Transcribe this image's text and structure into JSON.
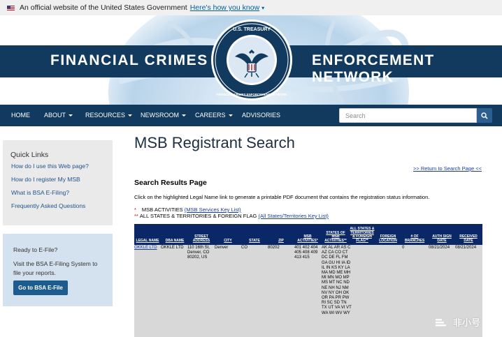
{
  "gov_banner": {
    "text": "An official website of the United States Government",
    "link": "Here's how you know",
    "chevron": "chevron-down-icon"
  },
  "header": {
    "left_title": "FINANCIAL CRIMES",
    "right_title": "ENFORCEMENT NETWORK",
    "seal_top_text": "U.S. TREASURY",
    "seal_ring_text": "FINANCIAL CRIMES ENFORCEMENT NETWORK",
    "brand_color": "#123a5e"
  },
  "nav": {
    "items": [
      {
        "label": "HOME",
        "dropdown": false
      },
      {
        "label": "ABOUT",
        "dropdown": true
      },
      {
        "label": "RESOURCES",
        "dropdown": true
      },
      {
        "label": "NEWSROOM",
        "dropdown": true
      },
      {
        "label": "CAREERS",
        "dropdown": true
      },
      {
        "label": "ADVISORIES",
        "dropdown": false
      }
    ],
    "search_placeholder": "Search",
    "search_icon": "search-icon"
  },
  "sidebar": {
    "quick_links_title": "Quick Links",
    "quick_links": [
      "How do I use this Web page?",
      "How do I register My MSB",
      "What is BSA E-Filing?",
      "Frequently Asked Questions"
    ],
    "efile": {
      "title": "Ready to E-File?",
      "text": "Visit the BSA E-Filing System to file your reports.",
      "button": "Go to BSA E-File"
    }
  },
  "main": {
    "title": "MSB Registrant Search",
    "return_link": ">> Return to Search Page <<",
    "results_heading": "Search Results Page",
    "instructions": "Click on the highlighted Legal Name link to generate a printable PDF document that contains the registration status information.",
    "legend": [
      {
        "marker": "*",
        "text": "MSB ACTIVITIES",
        "link": "(MSB Services Key List)"
      },
      {
        "marker": "**",
        "text": "ALL STATES & TERRITORIES & FOREIGN FLAG",
        "link": "(All States/Territories Key List)"
      }
    ]
  },
  "table": {
    "columns": [
      "LEGAL NAME",
      "DBA NAME",
      "STREET ADDRESS",
      "CITY",
      "STATE",
      "ZIP",
      "MSB ACTIVITIES*",
      "STATES OF MSB ACTIVITIES**",
      "ALL STATES & TERRITORIES & FOREIGN FLAG**",
      "FOREIGN LOCATION",
      "# OF BRANCHES",
      "AUTH SIGN DATE",
      "RECEIVED DATE"
    ],
    "rows": [
      {
        "legal_name": "OKKLE LTD",
        "dba_name": "OKKLE LTD",
        "street": "110 16th St, Denver, CO 80202, US",
        "city": "Denver",
        "state": "CO",
        "zip": "80202",
        "activities": "401 402 404 405 408 409 413 415",
        "states": "AK AL AR AS C AZ CA CO CT DC DE FL FM GA GU HI IA ID IL IN KS KY LA MA MD ME MH MI MN MO MP MS MT NC ND NE NH NJ NM NV NY OH OK OR PA PR PW RI SC SD TN TX UT VA VI VT WA WI WV WY",
        "all_states": "",
        "foreign_location": "",
        "branches": "0",
        "auth_sign_date": "08/21/2024",
        "received_date": "08/21/2024"
      }
    ],
    "header_color": "#0b2866",
    "body_color": "#d8d8d8"
  },
  "watermark": {
    "text": "非小号",
    "icon": "logo-mark-icon"
  }
}
